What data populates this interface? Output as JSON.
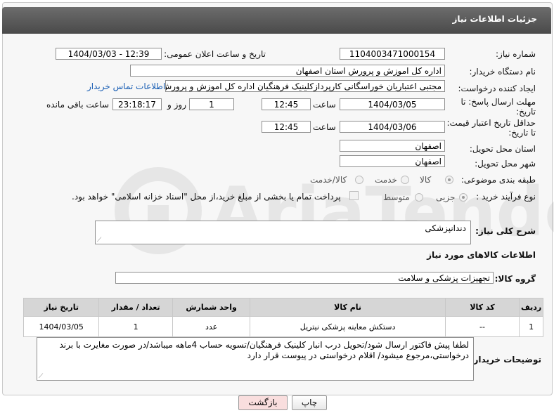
{
  "header": {
    "title": "جزئیات اطلاعات نیاز"
  },
  "fields": {
    "need_number_label": "شماره نیاز:",
    "need_number": "1104003471000154",
    "announce_label": "تاریخ و ساعت اعلان عمومی:",
    "announce_value": "1404/03/03 - 12:39",
    "buyer_label": "نام دستگاه خریدار:",
    "buyer_value": "اداره کل اموزش و پرورش استان اصفهان",
    "creator_label": "ایجاد کننده درخواست:",
    "creator_value": "مجتبی اعتباریان خوراسگانی کارپردازکلینیک فرهنگیان اداره کل اموزش و پرورش ا",
    "contact_link": "اطلاعات تماس خریدار",
    "deadline_label_1": "مهلت ارسال پاسخ: تا",
    "deadline_label_2": "تاریخ:",
    "deadline_date": "1404/03/05",
    "time_label": "ساعت",
    "deadline_time": "12:45",
    "days_value": "1",
    "days_label": "روز و",
    "remaining_value": "23:18:17",
    "remaining_label": "ساعت باقی مانده",
    "validity_label_1": "حداقل تاریخ اعتبار قیمت:",
    "validity_label_2": "تا تاریخ:",
    "validity_date": "1404/03/06",
    "validity_time_label": "ساعت",
    "validity_time": "12:45",
    "province_label": "استان محل تحویل:",
    "province_value": "اصفهان",
    "city_label": "شهر محل تحویل:",
    "city_value": "اصفهان",
    "category_label": "طبقه بندی موضوعی:",
    "category_options": [
      "کالا",
      "خدمت",
      "کالا/خدمت"
    ],
    "category_selected": "کالا",
    "process_label": "نوع فرآیند خرید :",
    "process_options": [
      "جزیی",
      "متوسط"
    ],
    "process_selected": "جزیی",
    "payment_note": "پرداخت تمام یا بخشی از مبلغ خرید،از محل \"اسناد خزانه اسلامی\" خواهد بود."
  },
  "description": {
    "label": "شرح کلی نیاز:",
    "value": "دندانپزشکی"
  },
  "goods_section": {
    "title": "اطلاعات کالاهای مورد نیاز",
    "group_label": "گروه کالا:",
    "group_value": "تجهیزات پزشکی و سلامت"
  },
  "table": {
    "headers": [
      "ردیف",
      "کد کالا",
      "نام کالا",
      "واحد شمارش",
      "تعداد / مقدار",
      "تاریخ نیاز"
    ],
    "rows": [
      [
        "1",
        "--",
        "دستکش معاینه پزشکی نیتریل",
        "عدد",
        "1",
        "1404/03/05"
      ]
    ]
  },
  "buyer_notes": {
    "label": "توضیحات خریدار:",
    "value": "لطفا پیش فاکتور ارسال شود/تحویل درب انبار کلینیک فرهنگیان/تسویه حساب 4ماهه میباشد/در صورت مغایرت با برند درخواستی،مرجوع میشود/ اقلام درخواستی در پیوست قرار دارد"
  },
  "buttons": {
    "print": "چاپ",
    "back": "بازگشت"
  },
  "watermark": "AriaTender.neT",
  "colors": {
    "header": "#555555",
    "link": "#1a5fb4",
    "back_button": "#f9dede"
  }
}
